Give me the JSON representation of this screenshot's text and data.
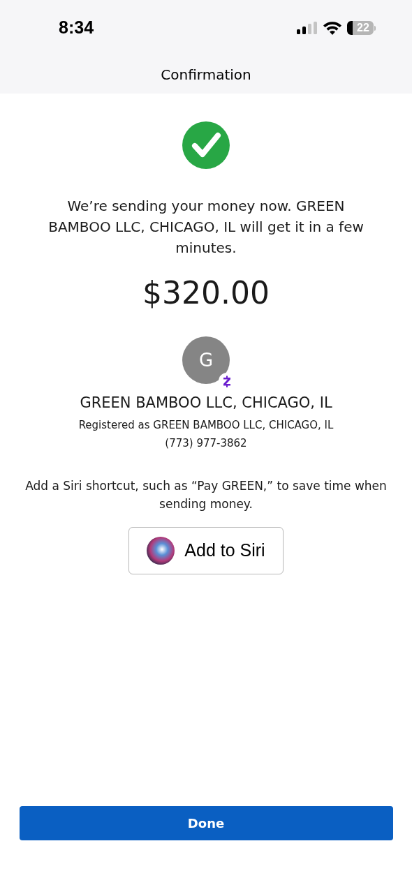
{
  "status_bar": {
    "time": "8:34",
    "battery": "22"
  },
  "header": {
    "title": "Confirmation"
  },
  "message": "We’re sending your money now. GREEN BAMBOO LLC, CHICAGO, IL will get it in a few minutes.",
  "amount": "$320.00",
  "recipient": {
    "initial": "G",
    "name": "GREEN BAMBOO LLC, CHICAGO, IL",
    "registered": "Registered as GREEN BAMBOO LLC, CHICAGO, IL",
    "phone": "(773) 977-3862"
  },
  "siri": {
    "hint": "Add a Siri shortcut, such as “Pay GREEN,” to save time when sending money.",
    "button": "Add to Siri"
  },
  "done_button": "Done"
}
